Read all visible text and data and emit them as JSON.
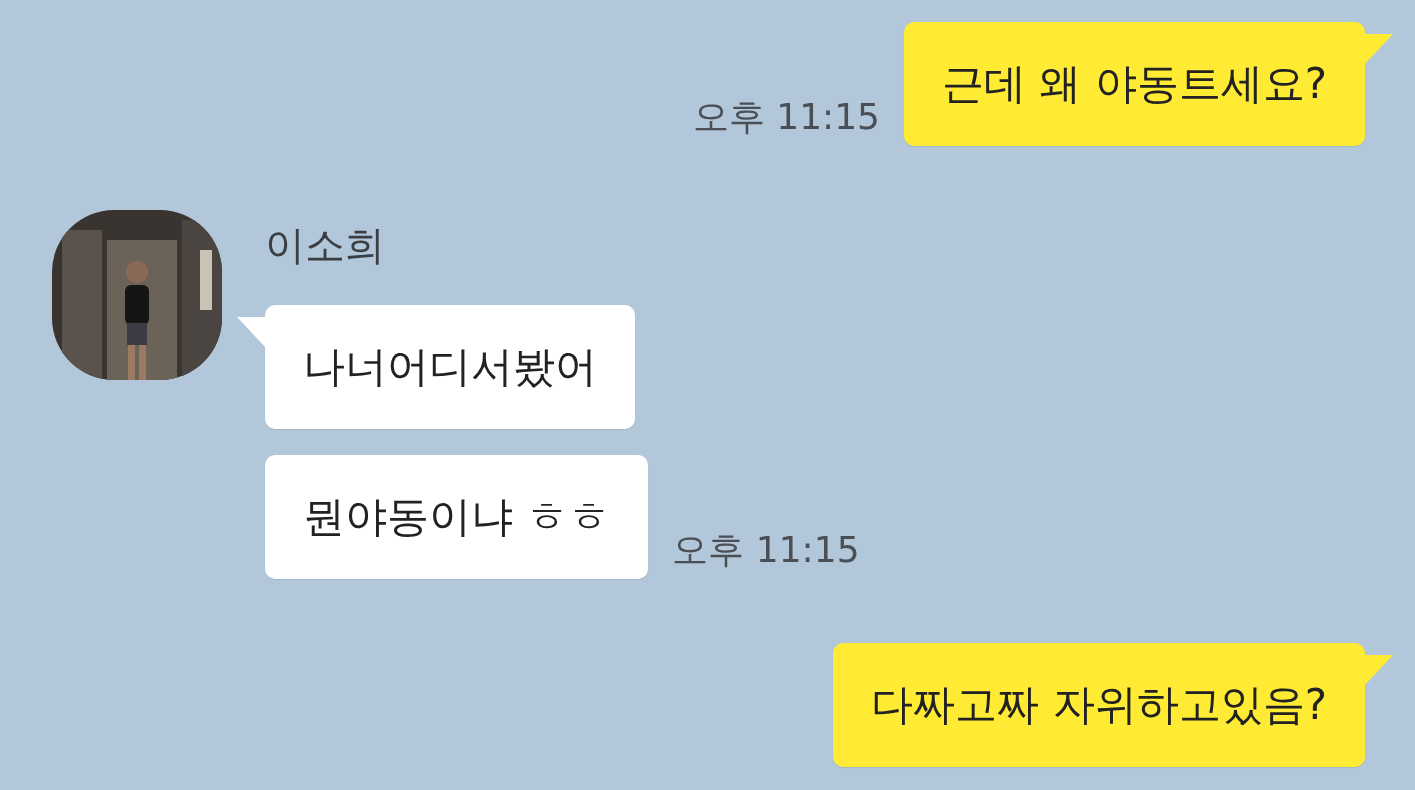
{
  "messages": [
    {
      "kind": "sent",
      "bubbles": [
        "근데 왜 야동트세요?"
      ],
      "time": "오후 11:15"
    },
    {
      "kind": "received",
      "sender": "이소희",
      "avatar": {
        "kind": "picture"
      },
      "bubbles": [
        "나너어디서봤어",
        "뭔야동이냐 ㅎㅎ"
      ],
      "time": "오후 11:15"
    },
    {
      "kind": "sent",
      "bubbles": [
        "다짜고짜 자위하고있음?"
      ]
    }
  ]
}
